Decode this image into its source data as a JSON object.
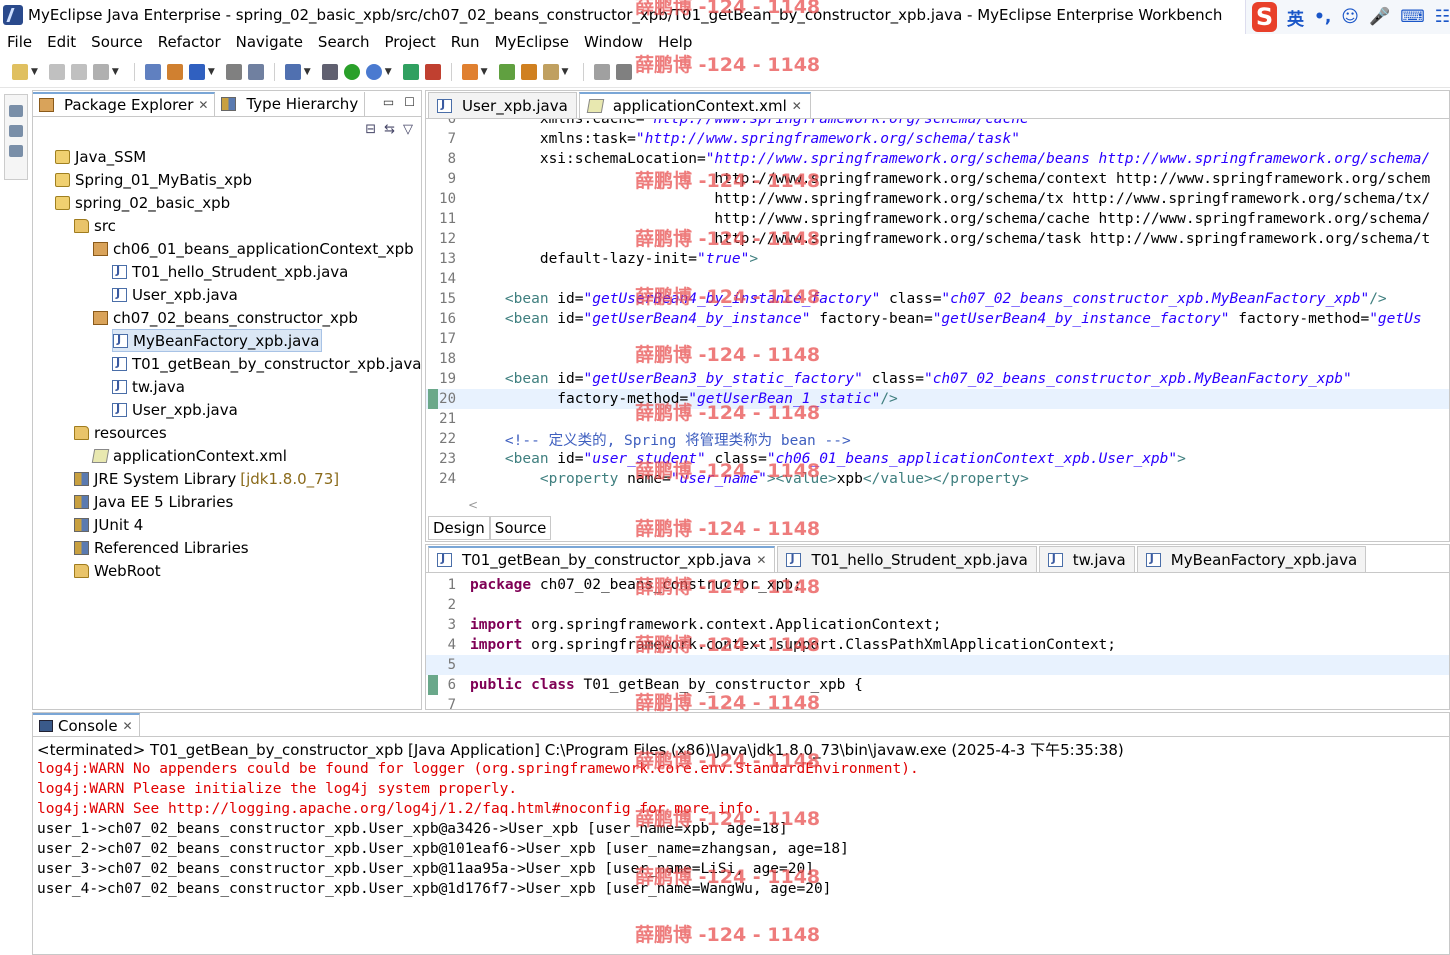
{
  "window": {
    "title": "MyEclipse Java Enterprise - spring_02_basic_xpb/src/ch07_02_beans_constructor_xpb/T01_getBean_by_constructor_xpb.java - MyEclipse Enterprise Workbench",
    "ime": {
      "logo": "S",
      "lang": "英",
      "punct": "•,",
      "emoji": "☺",
      "voice": "🎤",
      "keyboard": "⌨",
      "menu": "☷"
    }
  },
  "menu": [
    "File",
    "Edit",
    "Source",
    "Refactor",
    "Navigate",
    "Search",
    "Project",
    "Run",
    "MyEclipse",
    "Window",
    "Help"
  ],
  "toolbar": {
    "icons": [
      "new-icon",
      "save-icon",
      "save-all-icon",
      "print-icon",
      "new-web-icon",
      "box-icon",
      "box-blue-icon",
      "server-icon",
      "deploy-icon",
      "run-server-icon",
      "db-icon",
      "run-icon",
      "debug-icon",
      "coverage-icon",
      "external-tools-icon",
      "new-class-icon",
      "open-type-icon",
      "search-icon",
      "annotation-icon",
      "nav-back-icon",
      "nav-forward-icon"
    ],
    "colors": {
      "run": "#2aa02a",
      "debug": "#4a7ad0",
      "warn": "#d08020"
    }
  },
  "package_explorer": {
    "tab_label": "Package Explorer",
    "hierarchy_label": "Type Hierarchy",
    "tree": [
      {
        "label": "Java_SSM",
        "icon": "project-icon",
        "indent": 0
      },
      {
        "label": "Spring_01_MyBatis_xpb",
        "icon": "project-icon",
        "indent": 0
      },
      {
        "label": "spring_02_basic_xpb",
        "icon": "project-icon",
        "indent": 0
      },
      {
        "label": "src",
        "icon": "folder-icon",
        "indent": 1
      },
      {
        "label": "ch06_01_beans_applicationContext_xpb",
        "icon": "package-icon",
        "indent": 2
      },
      {
        "label": "T01_hello_Strudent_xpb.java",
        "icon": "java-file-icon",
        "indent": 3
      },
      {
        "label": "User_xpb.java",
        "icon": "java-file-icon",
        "indent": 3
      },
      {
        "label": "ch07_02_beans_constructor_xpb",
        "icon": "package-icon",
        "indent": 2
      },
      {
        "label": "MyBeanFactory_xpb.java",
        "icon": "java-file-icon",
        "indent": 3,
        "selected": true
      },
      {
        "label": "T01_getBean_by_constructor_xpb.java",
        "icon": "java-file-icon",
        "indent": 3
      },
      {
        "label": "tw.java",
        "icon": "java-file-icon",
        "indent": 3
      },
      {
        "label": "User_xpb.java",
        "icon": "java-file-icon",
        "indent": 3
      },
      {
        "label": "resources",
        "icon": "folder-icon",
        "indent": 1
      },
      {
        "label": "applicationContext.xml",
        "icon": "xml-file-icon",
        "indent": 2
      },
      {
        "label": "JRE System Library",
        "suffix": "[jdk1.8.0_73]",
        "icon": "library-icon",
        "indent": 1
      },
      {
        "label": "Java EE 5 Libraries",
        "icon": "library-icon",
        "indent": 1
      },
      {
        "label": "JUnit 4",
        "icon": "library-icon",
        "indent": 1
      },
      {
        "label": "Referenced Libraries",
        "icon": "library-icon",
        "indent": 1
      },
      {
        "label": "WebRoot",
        "icon": "folder-icon",
        "indent": 1
      }
    ]
  },
  "editor_top": {
    "tabs": [
      {
        "label": "User_xpb.java",
        "active": false
      },
      {
        "label": "applicationContext.xml",
        "active": true
      }
    ],
    "lines": [
      {
        "n": "6",
        "text": "        xmlns:cache=\"http://www.springframework.org/schema/cache\""
      },
      {
        "n": "7",
        "text": "        xmlns:task=\"http://www.springframework.org/schema/task\""
      },
      {
        "n": "8",
        "text": "        xsi:schemaLocation=\"http://www.springframework.org/schema/beans http://www.springframework.org/schema/"
      },
      {
        "n": "9",
        "text": "                            http://www.springframework.org/schema/context http://www.springframework.org/schem"
      },
      {
        "n": "10",
        "text": "                            http://www.springframework.org/schema/tx http://www.springframework.org/schema/tx/"
      },
      {
        "n": "11",
        "text": "                            http://www.springframework.org/schema/cache http://www.springframework.org/schema/"
      },
      {
        "n": "12",
        "text": "                            http://www.springframework.org/schema/task http://www.springframework.org/schema/t"
      },
      {
        "n": "13",
        "text": "        default-lazy-init=\"true\">"
      },
      {
        "n": "14",
        "text": ""
      },
      {
        "n": "15",
        "text": "    <bean id=\"getUserBean4_by_instance_factory\" class=\"ch07_02_beans_constructor_xpb.MyBeanFactory_xpb\"/>"
      },
      {
        "n": "16",
        "text": "    <bean id=\"getUserBean4_by_instance\" factory-bean=\"getUserBean4_by_instance_factory\" factory-method=\"getUs"
      },
      {
        "n": "17",
        "text": ""
      },
      {
        "n": "18",
        "text": ""
      },
      {
        "n": "19",
        "text": "    <bean id=\"getUserBean3_by_static_factory\" class=\"ch07_02_beans_constructor_xpb.MyBeanFactory_xpb\""
      },
      {
        "n": "20",
        "text": "          factory-method=\"getUserBean_1_static\"/>",
        "highlight": true
      },
      {
        "n": "21",
        "text": ""
      },
      {
        "n": "22",
        "text": "    <!-- 定义类的, Spring 将管理类称为 bean -->"
      },
      {
        "n": "23",
        "text": "    <bean id=\"user_student\" class=\"ch06_01_beans_applicationContext_xpb.User_xpb\">"
      },
      {
        "n": "24",
        "text": "        <property name=\"user_name\"><value>xpb</value></property>"
      }
    ],
    "design_tab": "Design",
    "source_tab": "Source"
  },
  "editor_bottom": {
    "tabs": [
      {
        "label": "T01_getBean_by_constructor_xpb.java",
        "active": true
      },
      {
        "label": "T01_hello_Strudent_xpb.java",
        "active": false
      },
      {
        "label": "tw.java",
        "active": false
      },
      {
        "label": "MyBeanFactory_xpb.java",
        "active": false
      }
    ],
    "lines": [
      {
        "n": "1",
        "text": "package ch07_02_beans_constructor_xpb;"
      },
      {
        "n": "2",
        "text": ""
      },
      {
        "n": "3",
        "text": "import org.springframework.context.ApplicationContext;"
      },
      {
        "n": "4",
        "text": "import org.springframework.context.support.ClassPathXmlApplicationContext;"
      },
      {
        "n": "5",
        "text": "",
        "highlight": true
      },
      {
        "n": "6",
        "text": "public class T01_getBean_by_constructor_xpb {"
      },
      {
        "n": "7",
        "text": ""
      }
    ]
  },
  "console": {
    "tab_label": "Console",
    "header": "<terminated> T01_getBean_by_constructor_xpb [Java Application] C:\\Program Files (x86)\\Java\\jdk1.8.0_73\\bin\\javaw.exe (2025-4-3 下午5:35:38)",
    "lines": [
      {
        "text": "log4j:WARN No appenders could be found for logger (org.springframework.core.env.StandardEnvironment).",
        "error": true
      },
      {
        "text": "log4j:WARN Please initialize the log4j system properly.",
        "error": true
      },
      {
        "text": "log4j:WARN See http://logging.apache.org/log4j/1.2/faq.html#noconfig for more info.",
        "error": true
      },
      {
        "text": "user_1->ch07_02_beans_constructor_xpb.User_xpb@a3426->User_xpb [user_name=xpb, age=18]",
        "error": false
      },
      {
        "text": "user_2->ch07_02_beans_constructor_xpb.User_xpb@101eaf6->User_xpb [user_name=zhangsan, age=18]",
        "error": false
      },
      {
        "text": "user_3->ch07_02_beans_constructor_xpb.User_xpb@11aa95a->User_xpb [user_name=LiSi, age=20]",
        "error": false
      },
      {
        "text": "user_4->ch07_02_beans_constructor_xpb.User_xpb@1d176f7->User_xpb [user_name=WangWu, age=20]",
        "error": false
      }
    ]
  },
  "watermark": "薛鹏博 -124 - 1148"
}
